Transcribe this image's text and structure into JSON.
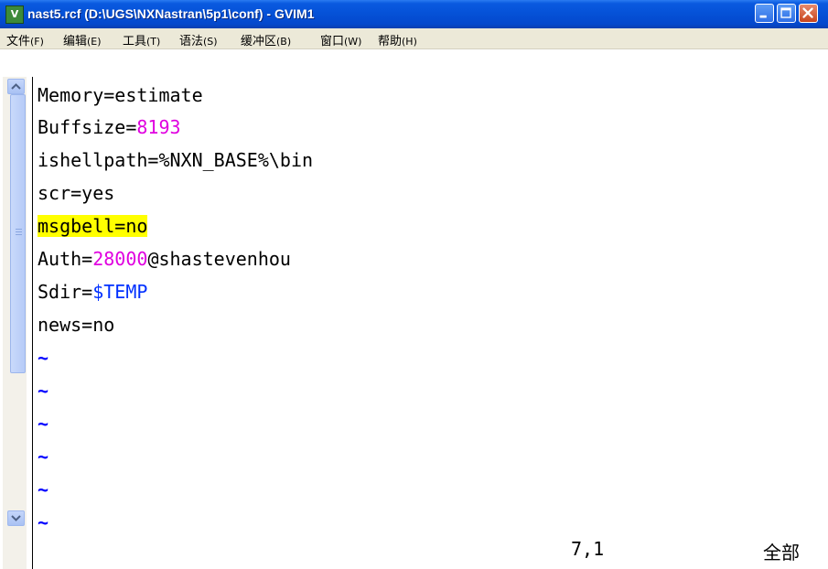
{
  "window": {
    "title": "nast5.rcf (D:\\UGS\\NXNastran\\5p1\\conf) - GVIM1",
    "icon_letter": "V"
  },
  "menu": [
    {
      "label": "文件",
      "accel": "(F)"
    },
    {
      "label": "编辑",
      "accel": "(E)"
    },
    {
      "label": "工具",
      "accel": "(T)"
    },
    {
      "label": "语法",
      "accel": "(S)"
    },
    {
      "label": "缓冲区",
      "accel": "(B)"
    },
    {
      "label": "窗口",
      "accel": "(W)"
    },
    {
      "label": "帮助",
      "accel": "(H)"
    }
  ],
  "editor": {
    "lines": [
      {
        "a": "Memory=estimate"
      },
      {
        "a": "Buffsize=",
        "num": "8193"
      },
      {
        "a": "ishellpath=%NXN_BASE%\\bin"
      },
      {
        "a": "scr=yes"
      },
      {
        "hl": "msgbell=no"
      },
      {
        "a": "Auth=",
        "num": "28000",
        "b": "@shastevenhou"
      },
      {
        "a": "Sdir=",
        "var": "$TEMP"
      },
      {
        "a": "news=no"
      }
    ],
    "tilde": "~",
    "empty_line_count": 6
  },
  "status": {
    "position": "7,1",
    "scroll": "全部"
  },
  "colors": {
    "number": "#e000e0",
    "variable": "#0030ff",
    "highlight": "#ffff00",
    "tilde": "#0000ff"
  }
}
